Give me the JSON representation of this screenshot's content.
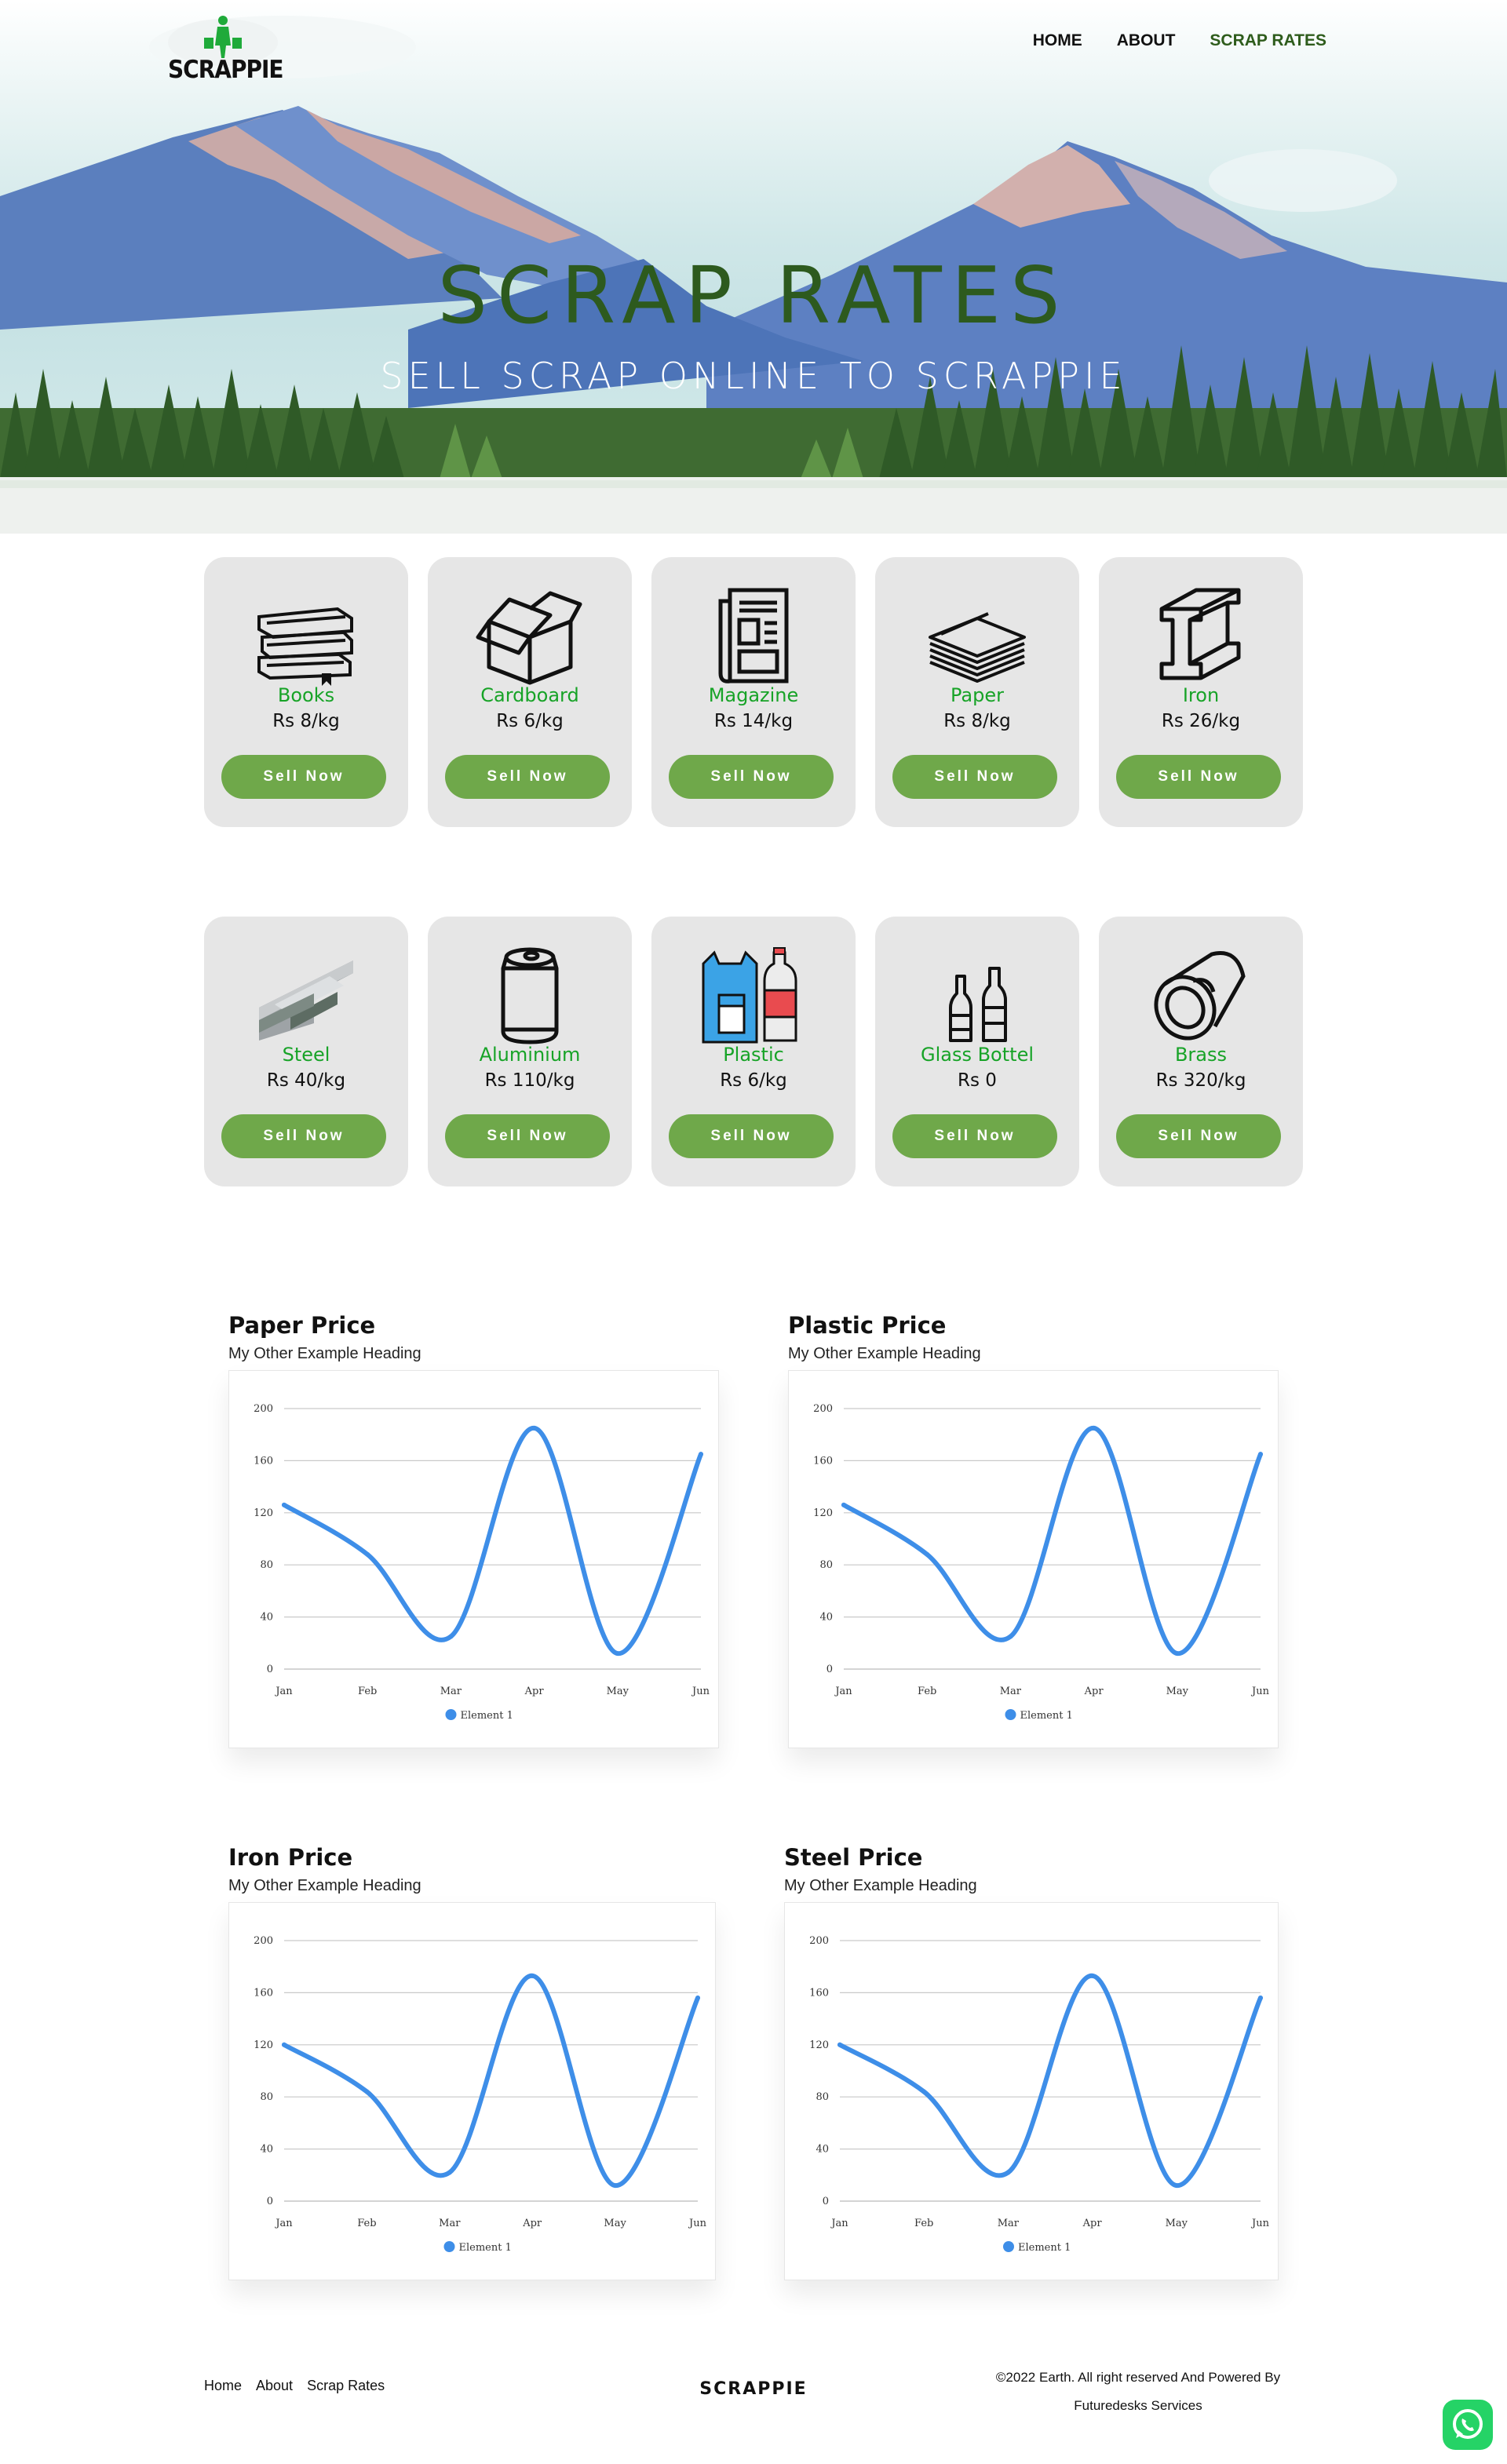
{
  "brand": {
    "logo_text": "SCRAPPIE"
  },
  "nav": {
    "items": [
      "HOME",
      "ABOUT",
      "SCRAP RATES"
    ],
    "active": "SCRAP RATES"
  },
  "hero": {
    "title": "SCRAP RATES",
    "subtitle": "SELL SCRAP ONLINE TO SCRAPPIE"
  },
  "products": [
    {
      "name": "Books",
      "rate": "Rs 8/kg",
      "button": "Sell Now",
      "icon": "books-icon"
    },
    {
      "name": "Cardboard",
      "rate": "Rs 6/kg",
      "button": "Sell Now",
      "icon": "box-icon"
    },
    {
      "name": "Magazine",
      "rate": "Rs 14/kg",
      "button": "Sell Now",
      "icon": "magazine-icon"
    },
    {
      "name": "Paper",
      "rate": "Rs 8/kg",
      "button": "Sell Now",
      "icon": "paper-stack-icon"
    },
    {
      "name": "Iron",
      "rate": "Rs 26/kg",
      "button": "Sell Now",
      "icon": "iron-beam-icon"
    },
    {
      "name": "Steel",
      "rate": "Rs 40/kg",
      "button": "Sell Now",
      "icon": "steel-beam-icon"
    },
    {
      "name": "Aluminium",
      "rate": "Rs 110/kg",
      "button": "Sell Now",
      "icon": "can-icon"
    },
    {
      "name": "Plastic",
      "rate": "Rs 6/kg",
      "button": "Sell Now",
      "icon": "plastic-items-icon"
    },
    {
      "name": "Glass Bottel",
      "rate": "Rs 0",
      "button": "Sell Now",
      "icon": "bottles-icon"
    },
    {
      "name": "Brass",
      "rate": "Rs 320/kg",
      "button": "Sell Now",
      "icon": "brass-pipe-icon"
    }
  ],
  "chart_data": [
    {
      "type": "line",
      "title": "Paper Price",
      "subtitle": "My Other Example Heading",
      "categories": [
        "Jan",
        "Feb",
        "Mar",
        "Apr",
        "May",
        "Jun"
      ],
      "series": [
        {
          "name": "Element 1",
          "values": [
            126,
            88,
            25,
            185,
            12,
            165
          ]
        }
      ],
      "ylim": [
        0,
        200
      ],
      "yticks": [
        0,
        40,
        80,
        120,
        160,
        200
      ],
      "grid": true,
      "legend": "bottom",
      "color": "#3e8ee8"
    },
    {
      "type": "line",
      "title": "Plastic Price",
      "subtitle": "My Other Example Heading",
      "categories": [
        "Jan",
        "Feb",
        "Mar",
        "Apr",
        "May",
        "Jun"
      ],
      "series": [
        {
          "name": "Element 1",
          "values": [
            126,
            88,
            25,
            185,
            12,
            165
          ]
        }
      ],
      "ylim": [
        0,
        200
      ],
      "yticks": [
        0,
        40,
        80,
        120,
        160,
        200
      ],
      "grid": true,
      "legend": "bottom",
      "color": "#3e8ee8"
    },
    {
      "type": "line",
      "title": "Iron Price",
      "subtitle": "My Other Example Heading",
      "categories": [
        "Jan",
        "Feb",
        "Mar",
        "Apr",
        "May",
        "Jun"
      ],
      "series": [
        {
          "name": "Element 1",
          "values": [
            120,
            84,
            22,
            173,
            12,
            156
          ]
        }
      ],
      "ylim": [
        0,
        200
      ],
      "yticks": [
        0,
        40,
        80,
        120,
        160,
        200
      ],
      "grid": true,
      "legend": "bottom",
      "color": "#3e8ee8"
    },
    {
      "type": "line",
      "title": "Steel Price",
      "subtitle": "My Other Example Heading",
      "categories": [
        "Jan",
        "Feb",
        "Mar",
        "Apr",
        "May",
        "Jun"
      ],
      "series": [
        {
          "name": "Element 1",
          "values": [
            120,
            84,
            22,
            173,
            12,
            156
          ]
        }
      ],
      "ylim": [
        0,
        200
      ],
      "yticks": [
        0,
        40,
        80,
        120,
        160,
        200
      ],
      "grid": true,
      "legend": "bottom",
      "color": "#3e8ee8"
    }
  ],
  "footer": {
    "links": [
      "Home",
      "About",
      "Scrap Rates"
    ],
    "brand": "SCRAPPIE",
    "copyright_line1": "©2022 Earth. All right reserved And Powered By",
    "copyright_line2": "Futuredesks Services"
  },
  "colors": {
    "accent_green": "#17a327",
    "button_green": "#6fa84a",
    "nav_active": "#2e5c1c",
    "line_blue": "#3e8ee8"
  }
}
